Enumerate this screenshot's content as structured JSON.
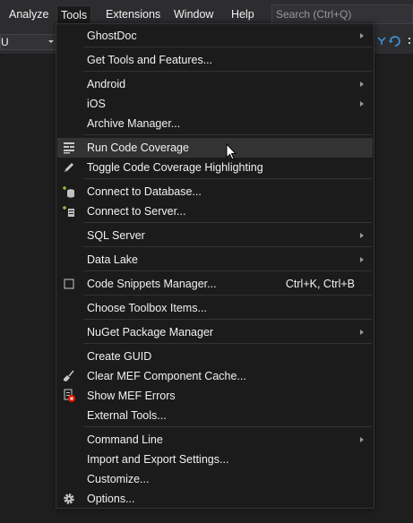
{
  "menubar": {
    "items": [
      "Analyze",
      "Tools",
      "Extensions",
      "Window",
      "Help"
    ],
    "search_placeholder": "Search (Ctrl+Q)"
  },
  "toolbar": {
    "combo_value": "U"
  },
  "menu": {
    "items": [
      {
        "label": "GhostDoc",
        "submenu": true
      },
      {
        "label": "Get Tools and Features..."
      },
      {
        "label": "Android",
        "submenu": true
      },
      {
        "label": "iOS",
        "submenu": true
      },
      {
        "label": "Archive Manager..."
      },
      {
        "label": "Run Code Coverage",
        "icon": "code-coverage-icon",
        "hovered": true
      },
      {
        "label": "Toggle Code Coverage Highlighting",
        "icon": "pencil-icon"
      },
      {
        "label": "Connect to Database...",
        "icon": "database-connect-icon"
      },
      {
        "label": "Connect to Server...",
        "icon": "server-connect-icon"
      },
      {
        "label": "SQL Server",
        "submenu": true
      },
      {
        "label": "Data Lake",
        "submenu": true
      },
      {
        "label": "Code Snippets Manager...",
        "shortcut": "Ctrl+K, Ctrl+B",
        "icon": "snippet-checkbox-icon"
      },
      {
        "label": "Choose Toolbox Items..."
      },
      {
        "label": "NuGet Package Manager",
        "submenu": true
      },
      {
        "label": "Create GUID"
      },
      {
        "label": "Clear MEF Component Cache...",
        "icon": "broom-icon"
      },
      {
        "label": "Show MEF Errors",
        "icon": "mef-errors-icon"
      },
      {
        "label": "External Tools..."
      },
      {
        "label": "Command Line",
        "submenu": true
      },
      {
        "label": "Import and Export Settings..."
      },
      {
        "label": "Customize..."
      },
      {
        "label": "Options...",
        "icon": "gear-icon"
      }
    ]
  },
  "colors": {
    "menu_bg": "#1b1b1c",
    "menubar_bg": "#2d2d30",
    "hover_bg": "#333334",
    "text": "#f1f1f1",
    "accent_blue": "#3d8fd1",
    "error_red": "#e51400"
  }
}
